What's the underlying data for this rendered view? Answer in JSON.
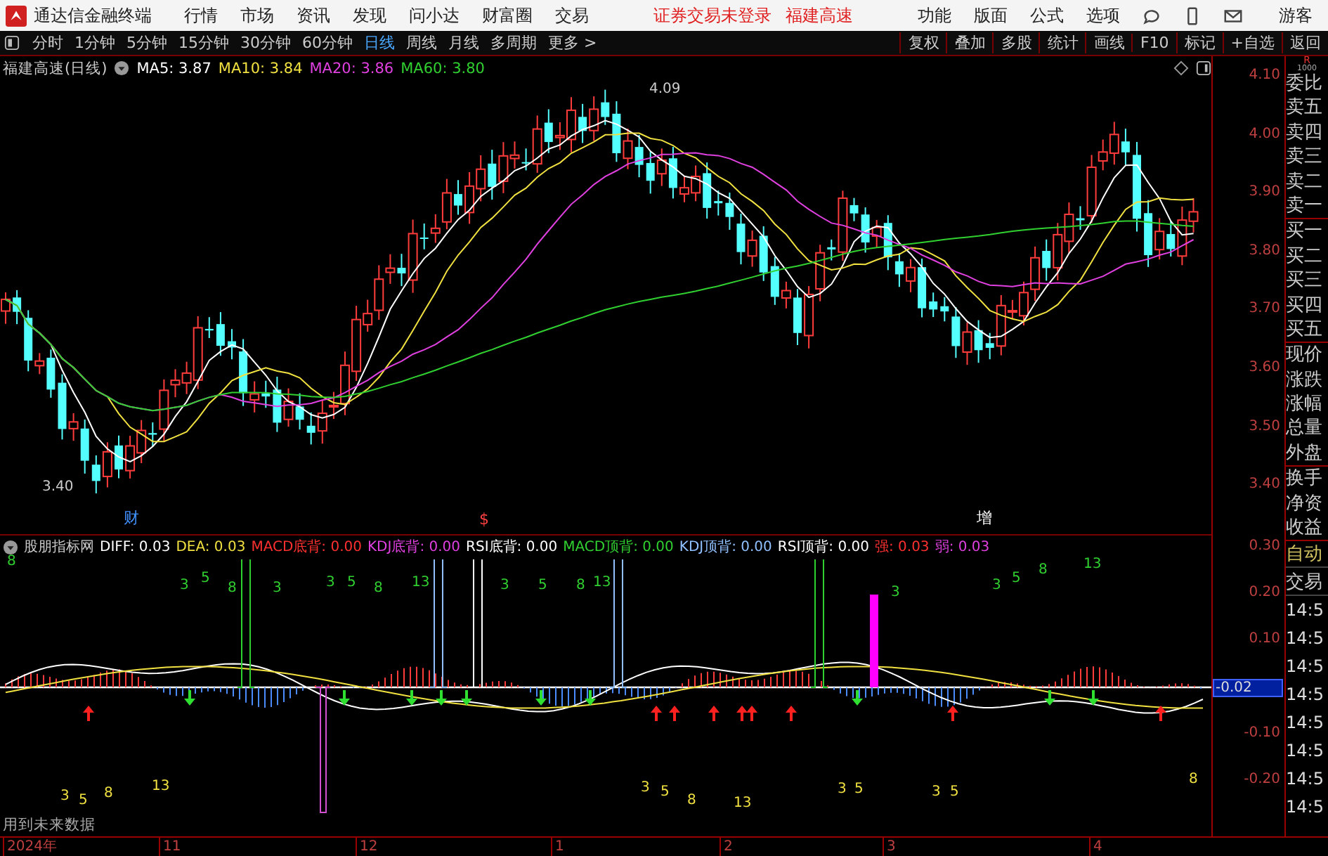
{
  "menu": {
    "app_title": "通达信金融终端",
    "items": [
      "行情",
      "市场",
      "资讯",
      "发现",
      "问小达",
      "财富圈",
      "交易"
    ],
    "notice": [
      "证券交易未登录",
      "福建高速"
    ],
    "right_items": [
      "功能",
      "版面",
      "公式",
      "选项"
    ],
    "user": "游客"
  },
  "toolbar": {
    "periods": [
      {
        "label": "分时",
        "selected": false
      },
      {
        "label": "1分钟",
        "selected": false
      },
      {
        "label": "5分钟",
        "selected": false
      },
      {
        "label": "15分钟",
        "selected": false
      },
      {
        "label": "30分钟",
        "selected": false
      },
      {
        "label": "60分钟",
        "selected": false
      },
      {
        "label": "日线",
        "selected": true
      },
      {
        "label": "周线",
        "selected": false
      },
      {
        "label": "月线",
        "selected": false
      },
      {
        "label": "多周期",
        "selected": false
      },
      {
        "label": "更多 >",
        "selected": false
      }
    ],
    "actions": [
      "复权",
      "叠加",
      "多股",
      "统计",
      "画线",
      "F10",
      "标记",
      "+自选",
      "返回"
    ]
  },
  "price_chart": {
    "title": "福建高速(日线)",
    "legend": [
      {
        "label": "MA5: 3.87",
        "color": "#ffffff"
      },
      {
        "label": "MA10: 3.84",
        "color": "#f0e040"
      },
      {
        "label": "MA20: 3.86",
        "color": "#e040e0"
      },
      {
        "label": "MA60: 3.80",
        "color": "#30d030"
      }
    ],
    "high_label": "4.09",
    "low_label": "3.40",
    "markers": [
      {
        "text": "财",
        "color": "#4090ff"
      },
      {
        "text": "$",
        "color": "#ff4040"
      },
      {
        "text": "增",
        "color": "#ffffff"
      }
    ],
    "axis": [
      "4.10",
      "4.00",
      "3.90",
      "3.80",
      "3.70",
      "3.60",
      "3.50",
      "3.40"
    ]
  },
  "indicator": {
    "name": "股朋指标网",
    "legend": [
      {
        "label": "DIFF: 0.03",
        "color": "#ffffff"
      },
      {
        "label": "DEA: 0.03",
        "color": "#f0e040"
      },
      {
        "label": "MACD底背: 0.00",
        "color": "#ff3030"
      },
      {
        "label": "KDJ底背: 0.00",
        "color": "#e040e0"
      },
      {
        "label": "RSI底背: 0.00",
        "color": "#ffffff"
      },
      {
        "label": "MACD顶背: 0.00",
        "color": "#30d030"
      },
      {
        "label": "KDJ顶背: 0.00",
        "color": "#90c0ff"
      },
      {
        "label": "RSI顶背: 0.00",
        "color": "#ffffff"
      },
      {
        "label": "强: 0.03",
        "color": "#ff3030"
      },
      {
        "label": "弱: 0.03",
        "color": "#e040e0"
      }
    ],
    "signal_numbers": [
      {
        "text": "8",
        "kind": "top"
      },
      {
        "text": "3",
        "kind": "top"
      },
      {
        "text": "5",
        "kind": "top"
      },
      {
        "text": "8",
        "kind": "top"
      },
      {
        "text": "3",
        "kind": "top"
      },
      {
        "text": "3",
        "kind": "top"
      },
      {
        "text": "5",
        "kind": "top"
      },
      {
        "text": "8",
        "kind": "top"
      },
      {
        "text": "13",
        "kind": "top"
      },
      {
        "text": "3",
        "kind": "top"
      },
      {
        "text": "5",
        "kind": "top"
      },
      {
        "text": "8",
        "kind": "top"
      },
      {
        "text": "13",
        "kind": "top"
      },
      {
        "text": "3",
        "kind": "top"
      },
      {
        "text": "3",
        "kind": "top"
      },
      {
        "text": "5",
        "kind": "top"
      },
      {
        "text": "8",
        "kind": "top"
      },
      {
        "text": "13",
        "kind": "top"
      },
      {
        "text": "3",
        "kind": "bottom"
      },
      {
        "text": "5",
        "kind": "bottom"
      },
      {
        "text": "8",
        "kind": "bottom"
      },
      {
        "text": "13",
        "kind": "bottom"
      },
      {
        "text": "3",
        "kind": "bottom"
      },
      {
        "text": "5",
        "kind": "bottom"
      },
      {
        "text": "8",
        "kind": "bottom"
      },
      {
        "text": "13",
        "kind": "bottom"
      },
      {
        "text": "3",
        "kind": "bottom"
      },
      {
        "text": "5",
        "kind": "bottom"
      },
      {
        "text": "3",
        "kind": "bottom"
      },
      {
        "text": "5",
        "kind": "bottom"
      },
      {
        "text": "8",
        "kind": "bottom"
      }
    ],
    "note": "用到未来数据",
    "axis": [
      {
        "label": "0.30",
        "selected": false
      },
      {
        "label": "0.20",
        "selected": false
      },
      {
        "label": "0.10",
        "selected": false
      },
      {
        "label": "-0.02",
        "selected": true
      },
      {
        "label": "-0.10",
        "selected": false
      },
      {
        "label": "-0.20",
        "selected": false
      }
    ]
  },
  "x_axis": [
    "2024年",
    "11",
    "12",
    "1",
    "2",
    "3",
    "4"
  ],
  "side_panel": {
    "corner": [
      "R",
      "1000"
    ],
    "quote_labels": [
      "委比",
      "卖五",
      "卖四",
      "卖三",
      "卖二",
      "卖一",
      "买一",
      "买二",
      "买三",
      "买四",
      "买五",
      "现价",
      "涨跌",
      "涨幅",
      "总量",
      "外盘",
      "换手",
      "净资",
      "收益"
    ],
    "tabs": [
      "自动",
      "交易"
    ],
    "times": [
      "14:5",
      "14:5",
      "14:5",
      "14:5",
      "14:5",
      "14:5",
      "14:5",
      "14:5"
    ]
  }
}
